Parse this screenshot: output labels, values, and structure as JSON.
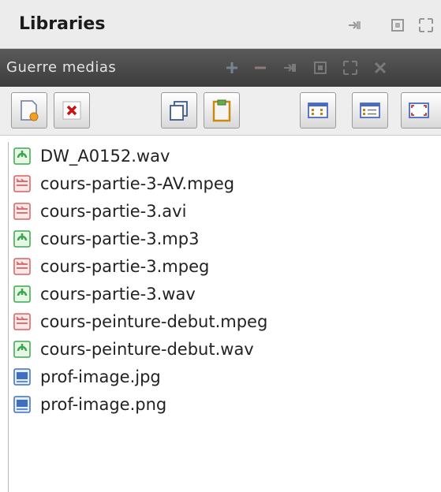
{
  "window": {
    "title": "Libraries"
  },
  "panel": {
    "title": "Guerre medias"
  },
  "files": [
    {
      "name": "DW_A0152.wav",
      "icon": "audio-file-icon"
    },
    {
      "name": "cours-partie-3-AV.mpeg",
      "icon": "video-file-icon"
    },
    {
      "name": "cours-partie-3.avi",
      "icon": "video-file-icon"
    },
    {
      "name": "cours-partie-3.mp3",
      "icon": "audio-file-icon"
    },
    {
      "name": "cours-partie-3.mpeg",
      "icon": "video-file-icon"
    },
    {
      "name": "cours-partie-3.wav",
      "icon": "audio-file-icon"
    },
    {
      "name": "cours-peinture-debut.mpeg",
      "icon": "video-file-icon"
    },
    {
      "name": "cours-peinture-debut.wav",
      "icon": "audio-file-icon"
    },
    {
      "name": "prof-image.jpg",
      "icon": "image-file-icon"
    },
    {
      "name": "prof-image.png",
      "icon": "image-file-icon"
    }
  ],
  "colors": {
    "panel_header": "#3c3c3c",
    "audio_icon": "#3aa84a",
    "video_icon": "#d96060",
    "image_icon": "#3f6fc4"
  }
}
